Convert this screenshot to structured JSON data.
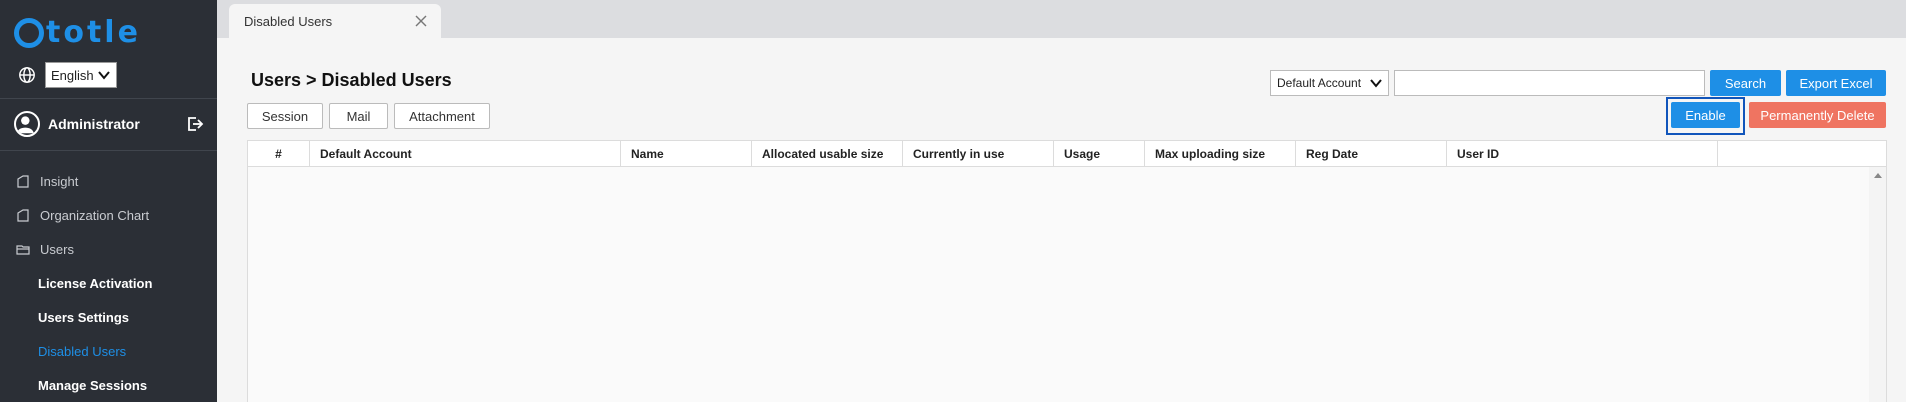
{
  "brand": {
    "name": "totle",
    "color": "#1e8fe6"
  },
  "language": {
    "selected": "English"
  },
  "user": {
    "name": "Administrator"
  },
  "nav": {
    "items": [
      {
        "label": "Insight",
        "icon": "page-icon"
      },
      {
        "label": "Organization Chart",
        "icon": "page-icon"
      },
      {
        "label": "Users",
        "icon": "folder-icon"
      }
    ],
    "subitems": [
      {
        "label": "License Activation",
        "active": false
      },
      {
        "label": "Users Settings",
        "active": false
      },
      {
        "label": "Disabled Users",
        "active": true
      },
      {
        "label": "Manage Sessions",
        "active": false
      }
    ]
  },
  "tab": {
    "label": "Disabled Users"
  },
  "page": {
    "title": "Users > Disabled Users"
  },
  "filters": {
    "session": "Session",
    "mail": "Mail",
    "attachment": "Attachment"
  },
  "toolbar": {
    "account_select": "Default Account",
    "search_value": "",
    "search_label": "Search",
    "export_label": "Export Excel",
    "enable_label": "Enable",
    "delete_label": "Permanently Delete"
  },
  "table": {
    "columns": [
      "#",
      "Default Account",
      "Name",
      "Allocated usable size",
      "Currently in use",
      "Usage",
      "Max uploading size",
      "Reg Date",
      "User ID"
    ],
    "rows": []
  },
  "colors": {
    "accent": "#1e8fe6",
    "danger": "#ef7461",
    "sidebar": "#2b2f36"
  }
}
